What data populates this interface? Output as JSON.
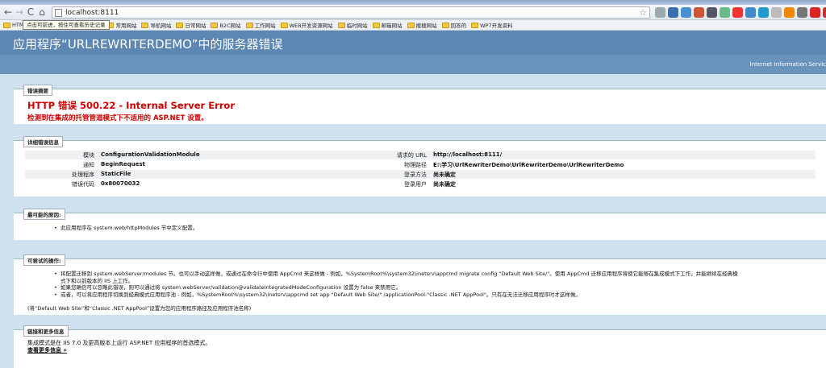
{
  "browser": {
    "url": "localhost:8111",
    "tooltip": "点击可前进，按住可查看历史记录",
    "bookmarks": [
      "HTM",
      "网站",
      "常用网站",
      "导航网站",
      "日常网站",
      "B2C网站",
      "工作网站",
      "WEB开发资源网站",
      "临时网站",
      "邮箱网站",
      "搜搜网站",
      "回答的",
      "WP7开发资料"
    ]
  },
  "header": {
    "title": "应用程序“URLREWRITERDEMO”中的服务器错误",
    "subtitle": "Internet Information Servic"
  },
  "summary": {
    "legend": "错误摘要",
    "title": "HTTP 错误 500.22 - Internal Server Error",
    "description": "检测到在集成的托管管道模式下不适用的 ASP.NET 设置。"
  },
  "details": {
    "legend": "详细错误信息",
    "left": [
      {
        "label": "模块",
        "value": "ConfigurationValidationModule"
      },
      {
        "label": "通知",
        "value": "BeginRequest"
      },
      {
        "label": "处理程序",
        "value": "StaticFile"
      },
      {
        "label": "错误代码",
        "value": "0x80070032"
      }
    ],
    "right": [
      {
        "label": "请求的 URL",
        "value": "http://localhost:8111/"
      },
      {
        "label": "物理路径",
        "value": "E:\\学习\\UrlRewriterDemo\\UrlRewriterDemo\\UrlRewriterDemo"
      },
      {
        "label": "登录方法",
        "value": "尚未确定"
      },
      {
        "label": "登录用户",
        "value": "尚未确定"
      }
    ]
  },
  "causes": {
    "legend": "最可能的原因:",
    "items": [
      "此应用程序在 system.web/httpModules 节中定义配置。"
    ]
  },
  "actions": {
    "legend": "可尝试的操作:",
    "item1_line1": "将配置迁移到 system.webServer/modules 节。也可以手动这样做，或通过在命令行中使用 AppCmd 来这样做 - 例如，%SystemRoot%\\system32\\inetsrv\\appcmd migrate config \"Default Web Site/\"。使用 AppCmd 迁移应用程序将使它能够在集成模式下工作，并能继续在经典模",
    "item1_line2": "式下和以前版本的 IIS 上工作。",
    "item2": "如果您确信可以忽略此错误，则可以通过将 system.webServer/validation@validateIntegratedModeConfiguration 设置为 false 来禁用它。",
    "item3": "或者，可以将应用程序切换到经典模式应用程序池 - 例如，%SystemRoot%\\system32\\inetsrv\\appcmd set app \"Default Web Site/\" /applicationPool:\"Classic .NET AppPool\"。只有在无法迁移应用程序时才这样做。",
    "note": "(将“Default Web Site”和“Classic .NET AppPool”设置为您的应用程序路径及应用程序池名称)"
  },
  "links": {
    "legend": "链接和更多信息",
    "text": "集成模式是在 IIS 7.0 及更高版本上运行 ASP.NET 应用程序的首选模式。",
    "more": "查看更多信息 »"
  }
}
